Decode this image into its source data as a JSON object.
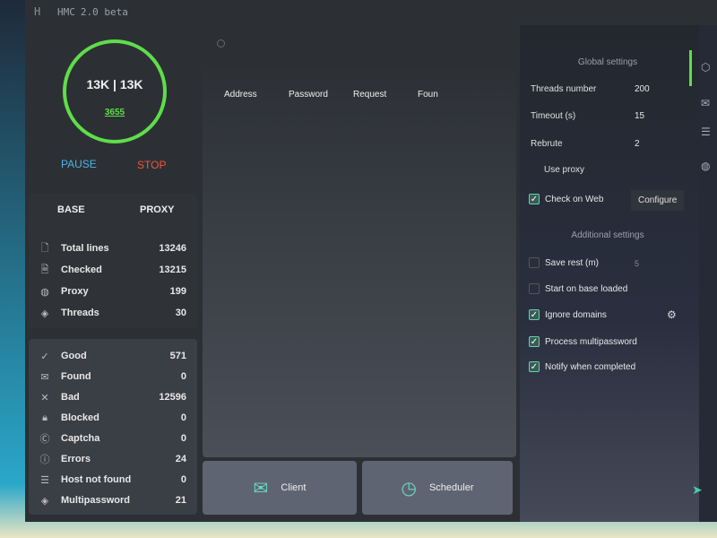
{
  "app": {
    "title": "HMC",
    "version": "2.0 beta"
  },
  "progress": {
    "main": "13K | 13K",
    "sub": "3655",
    "ring_fraction": 1.0
  },
  "controls": {
    "pause_label": "PAUSE",
    "stop_label": "STOP"
  },
  "tabs": {
    "base": "BASE",
    "proxy": "PROXY"
  },
  "base_stats": [
    {
      "icon": "file-icon",
      "label": "Total lines",
      "value": "13246"
    },
    {
      "icon": "file-check-icon",
      "label": "Checked",
      "value": "13215"
    },
    {
      "icon": "globe-icon",
      "label": "Proxy",
      "value": "199"
    },
    {
      "icon": "layers-icon",
      "label": "Threads",
      "value": "30"
    }
  ],
  "results": [
    {
      "icon": "check-icon",
      "label": "Good",
      "value": "571"
    },
    {
      "icon": "mail-icon",
      "label": "Found",
      "value": "0"
    },
    {
      "icon": "x-icon",
      "label": "Bad",
      "value": "12596"
    },
    {
      "icon": "lock-icon",
      "label": "Blocked",
      "value": "0"
    },
    {
      "icon": "captcha-icon",
      "label": "Captcha",
      "value": "0"
    },
    {
      "icon": "alert-icon",
      "label": "Errors",
      "value": "24"
    },
    {
      "icon": "server-icon",
      "label": "Host not found",
      "value": "0"
    },
    {
      "icon": "layers-icon",
      "label": "Multipassword",
      "value": "21"
    }
  ],
  "search": {
    "placeholder": ""
  },
  "table": {
    "columns": [
      "Address",
      "Password",
      "Request",
      "Foun"
    ]
  },
  "bottom_buttons": {
    "client": "Client",
    "scheduler": "Scheduler"
  },
  "settings": {
    "global_title": "Global settings",
    "threads_label": "Threads number",
    "threads_value": "200",
    "timeout_label": "Timeout (s)",
    "timeout_value": "15",
    "rebrute_label": "Rebrute",
    "rebrute_value": "2",
    "use_proxy_label": "Use proxy",
    "check_on_web_label": "Check on Web",
    "check_on_web": true,
    "configure_label": "Configure",
    "additional_title": "Additional settings",
    "save_rest_label": "Save rest (m)",
    "save_rest": false,
    "save_rest_value": "5",
    "start_on_base_label": "Start on base loaded",
    "start_on_base": false,
    "ignore_domains_label": "Ignore domains",
    "ignore_domains": true,
    "process_multipassword_label": "Process multipassword",
    "process_multipassword": true,
    "notify_label": "Notify when completed",
    "notify": true
  },
  "colors": {
    "accent_green": "#5fdd4a",
    "pause_blue": "#4db3e6",
    "stop_red": "#f2553a",
    "teal": "#5fd3b4"
  }
}
